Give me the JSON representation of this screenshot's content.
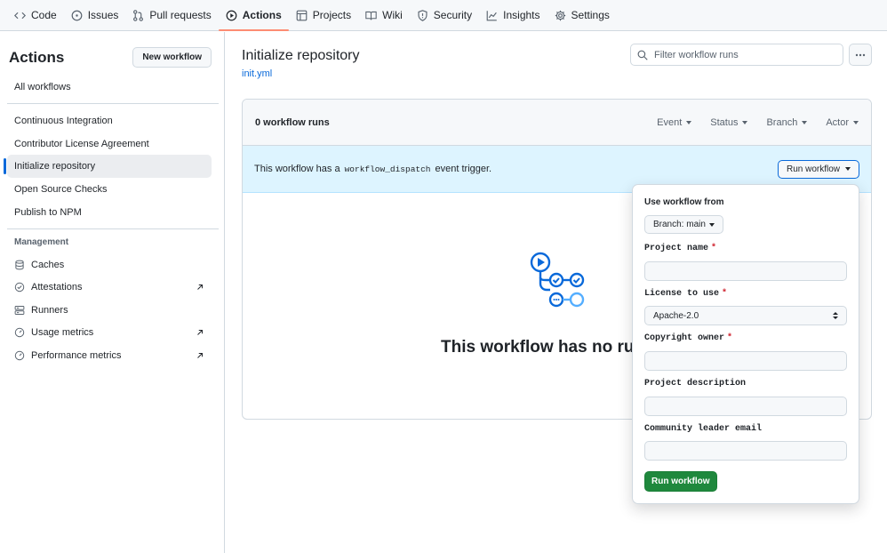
{
  "nav": {
    "tabs": [
      {
        "label": "Code",
        "icon": "code-icon"
      },
      {
        "label": "Issues",
        "icon": "issue-icon"
      },
      {
        "label": "Pull requests",
        "icon": "pull-request-icon"
      },
      {
        "label": "Actions",
        "icon": "play-icon",
        "active": true
      },
      {
        "label": "Projects",
        "icon": "table-icon"
      },
      {
        "label": "Wiki",
        "icon": "book-icon"
      },
      {
        "label": "Security",
        "icon": "shield-icon"
      },
      {
        "label": "Insights",
        "icon": "graph-icon"
      },
      {
        "label": "Settings",
        "icon": "gear-icon"
      }
    ]
  },
  "sidebar": {
    "title": "Actions",
    "new_workflow_label": "New workflow",
    "all_workflows": "All workflows",
    "workflows": [
      {
        "label": "Continuous Integration"
      },
      {
        "label": "Contributor License Agreement"
      },
      {
        "label": "Initialize repository",
        "selected": true
      },
      {
        "label": "Open Source Checks"
      },
      {
        "label": "Publish to NPM"
      }
    ],
    "management_heading": "Management",
    "management": [
      {
        "label": "Caches",
        "icon": "database-icon",
        "external": false
      },
      {
        "label": "Attestations",
        "icon": "verified-icon",
        "external": true
      },
      {
        "label": "Runners",
        "icon": "server-icon",
        "external": false
      },
      {
        "label": "Usage metrics",
        "icon": "meter-icon",
        "external": true
      },
      {
        "label": "Performance metrics",
        "icon": "meter-icon",
        "external": true
      }
    ]
  },
  "main": {
    "title": "Initialize repository",
    "file_link": "init.yml",
    "filter_placeholder": "Filter workflow runs",
    "runs_count": "0 workflow runs",
    "filters": [
      "Event",
      "Status",
      "Branch",
      "Actor"
    ],
    "dispatch_text_before": "This workflow has a",
    "dispatch_code": "workflow_dispatch",
    "dispatch_text_after": "event trigger.",
    "run_workflow_label": "Run workflow",
    "empty_title": "This workflow has no runs yet."
  },
  "popover": {
    "use_from_label": "Use workflow from",
    "branch_label": "Branch: main",
    "fields": {
      "project_name": {
        "label": "Project name",
        "required": "*",
        "value": ""
      },
      "license": {
        "label": "License to use",
        "required": "*",
        "value": "Apache-2.0"
      },
      "copyright_owner": {
        "label": "Copyright owner",
        "required": "*",
        "value": ""
      },
      "project_description": {
        "label": "Project description",
        "value": ""
      },
      "leader_email": {
        "label": "Community leader email",
        "value": ""
      }
    },
    "submit_label": "Run workflow"
  },
  "colors": {
    "accent": "#0969da",
    "active_tab_underline": "#fd8c73",
    "submit_green": "#1f883d",
    "dispatch_bg": "#ddf4ff",
    "required_red": "#cf222e"
  }
}
